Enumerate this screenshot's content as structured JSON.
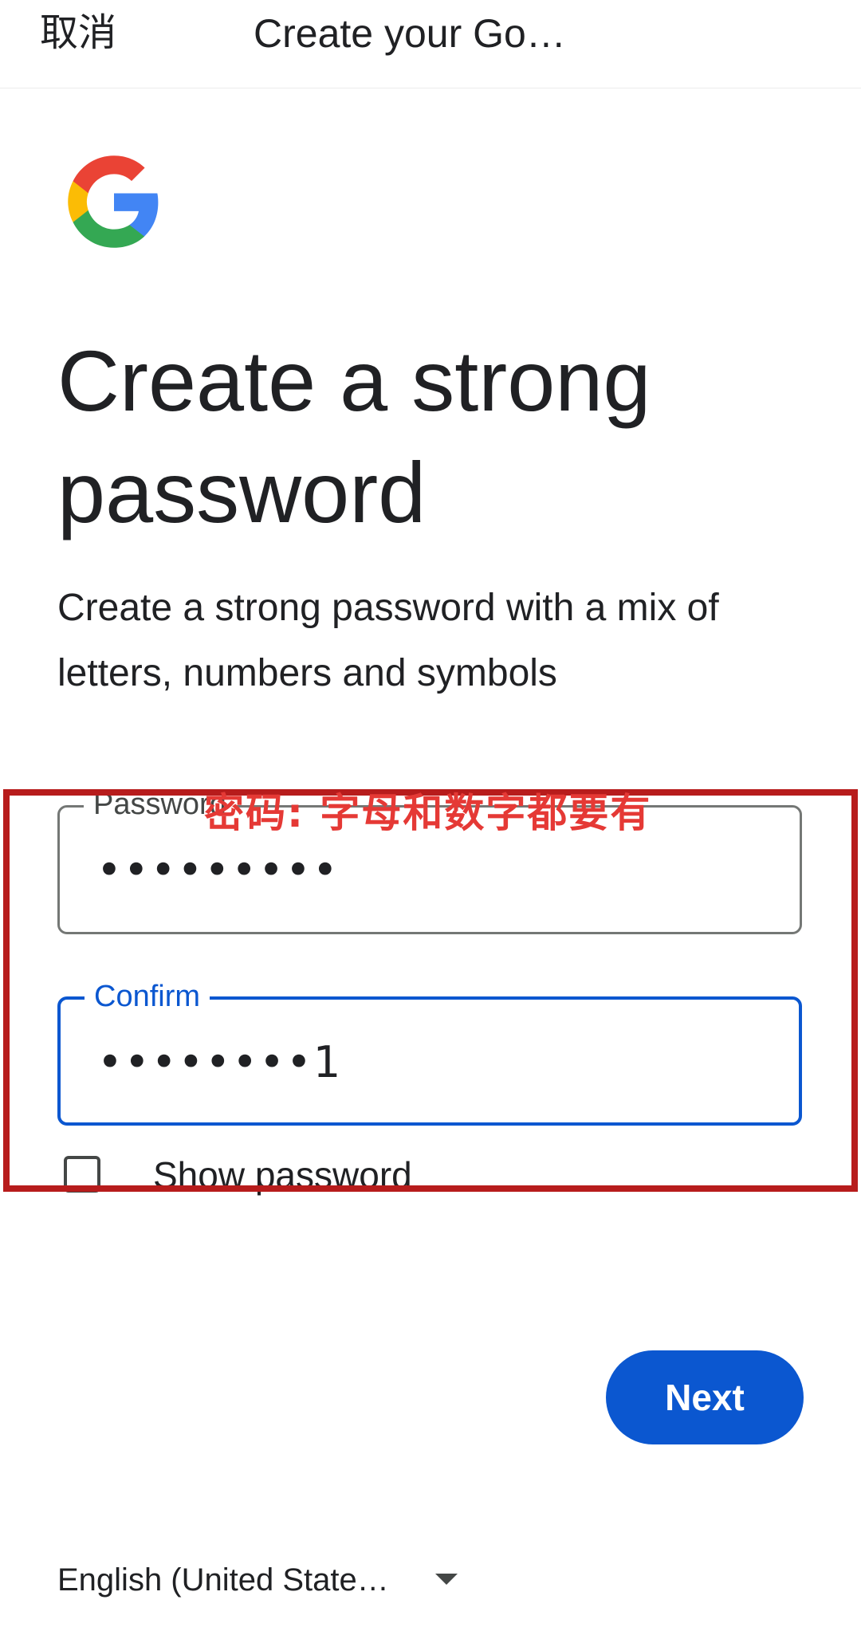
{
  "topbar": {
    "cancel_label": "取消",
    "title": "Create your Go…"
  },
  "logo": {
    "icon": "google-g-logo"
  },
  "main": {
    "headline": "Create a strong password",
    "subtext": "Create a strong password with a mix of letters, numbers and symbols"
  },
  "fields": {
    "password": {
      "label": "Password",
      "value": "•••••••••"
    },
    "confirm": {
      "label": "Confirm",
      "value": "••••••••1"
    }
  },
  "show_password": {
    "label": "Show password",
    "checked": false
  },
  "annotation": {
    "text": "密码: 字母和数字都要有",
    "color": "#e53935"
  },
  "actions": {
    "next_label": "Next"
  },
  "footer": {
    "language_label": "English (United State…"
  },
  "colors": {
    "accent": "#0b57d0",
    "annotation_border": "#b71c1c"
  }
}
